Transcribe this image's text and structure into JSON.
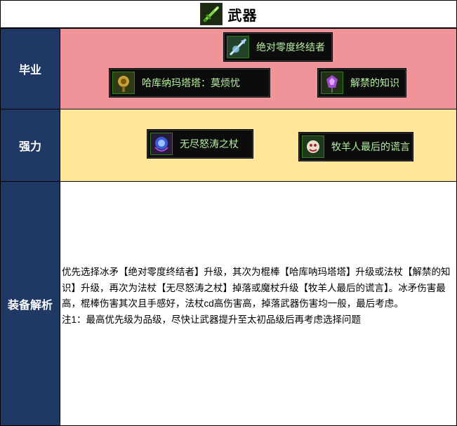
{
  "title": {
    "text": "武器",
    "icon": "green-sword-icon"
  },
  "rows": {
    "graduate": {
      "label": "毕业",
      "bg_color": "#f0949a",
      "items": [
        {
          "name": "绝对零度终结者",
          "icon": "ice-spear-icon"
        },
        {
          "name": "哈库纳玛塔塔：莫烦忧",
          "icon": "golden-mace-icon"
        },
        {
          "name": "解禁的知识",
          "icon": "purple-staff-icon"
        }
      ]
    },
    "strong": {
      "label": "强力",
      "bg_color": "#ffe699",
      "items": [
        {
          "name": "无尽怒涛之杖",
          "icon": "blue-orb-staff-icon"
        },
        {
          "name": "牧羊人最后的谎言",
          "icon": "shepherd-crook-icon"
        }
      ]
    },
    "analysis": {
      "label": "装备解析",
      "paragraph": "优先选择冰矛【绝对零度终结者】升级，其次为棍棒【哈库呐玛塔塔】升级或法杖【解禁的知识】升级，再次为法杖【无尽怒涛之杖】掉落或魔杖升级【牧羊人最后的谎言】。冰矛伤害最高，棍棒伤害其次且手感好，法杖cd高伤害高，掉落武器伤害均一般，最后考虑。",
      "note": "注1：最高优先级为品级，尽快让武器提升至太初品级后再考虑选择问题"
    }
  },
  "colors": {
    "label_bg": "#1f3864",
    "label_text": "#ffffff",
    "item_bg": "#0c0c0c",
    "item_text": "#b6f0a0"
  }
}
